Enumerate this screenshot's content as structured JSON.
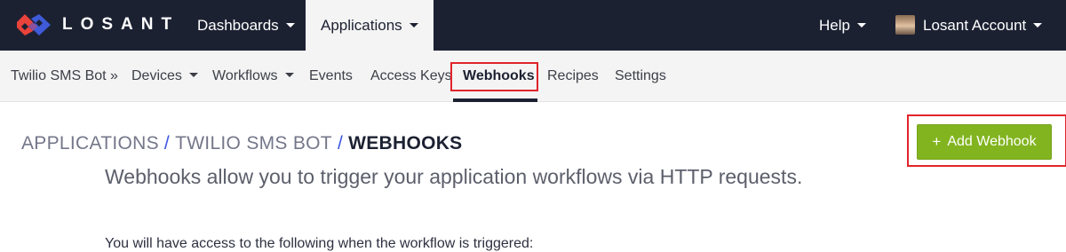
{
  "brand": {
    "name": "LOSANT"
  },
  "topnav": {
    "dashboards": "Dashboards",
    "applications": "Applications",
    "help": "Help",
    "account": "Losant Account"
  },
  "subnav": {
    "app": "Twilio SMS Bot »",
    "devices": "Devices",
    "workflows": "Workflows",
    "events": "Events",
    "access_keys": "Access Keys",
    "webhooks": "Webhooks",
    "recipes": "Recipes",
    "settings": "Settings"
  },
  "breadcrumb": {
    "part1": "APPLICATIONS",
    "sep1": "/",
    "part2": "TWILIO SMS BOT",
    "sep2": "/",
    "current": "WEBHOOKS"
  },
  "actions": {
    "add_webhook": "Add Webhook",
    "add_icon": "plus-icon"
  },
  "content": {
    "lead": "Webhooks allow you to trigger your application workflows via HTTP requests.",
    "para": "You will have access to the following when the workflow is triggered:"
  },
  "colors": {
    "topbar": "#1c2132",
    "accent_green": "#82b41f",
    "highlight_red": "#e0242b",
    "breadcrumb_sep": "#3b55e0"
  }
}
